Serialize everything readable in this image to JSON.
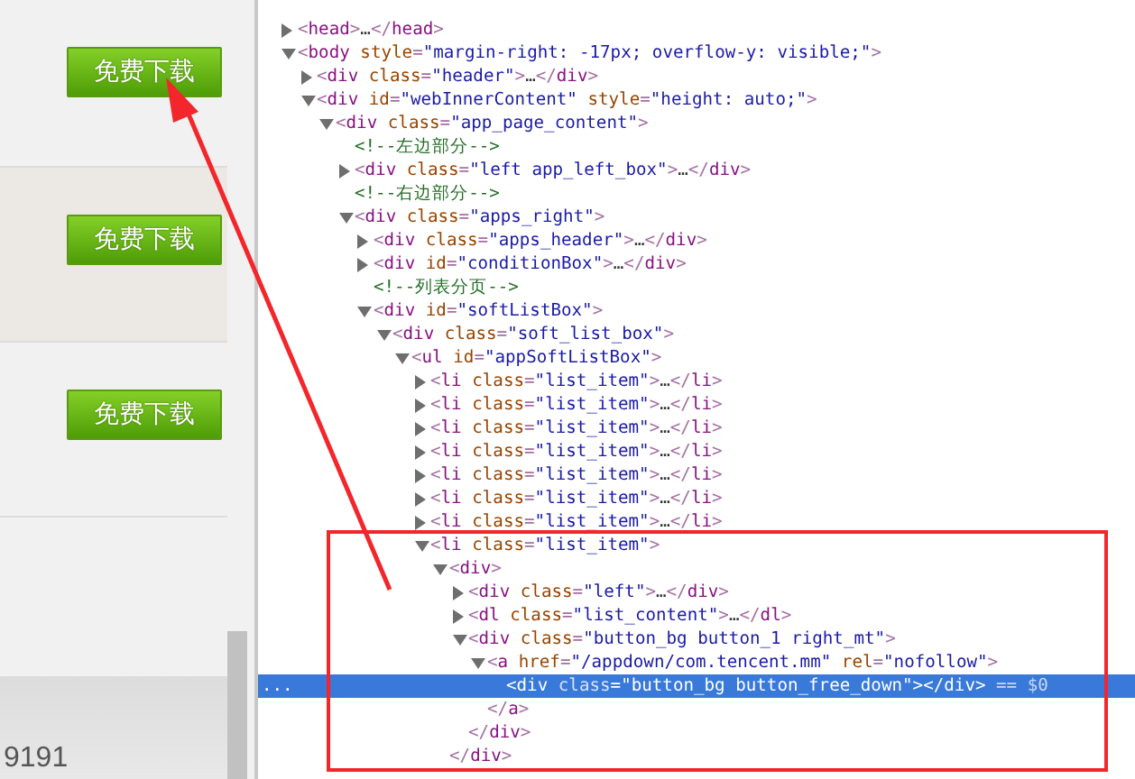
{
  "web_page": {
    "list_items": [
      {
        "button_label": "免费下载",
        "highlighted": false
      },
      {
        "button_label": "免费下载",
        "highlighted": true
      },
      {
        "button_label": "免费下载",
        "highlighted": false
      }
    ],
    "footer_text": "9191"
  },
  "dom_tree": [
    {
      "kind": "element",
      "text": "<head>…</head>",
      "expanded": false,
      "selected": false
    },
    {
      "kind": "element",
      "text": "<body style=\"margin-right: -17px; overflow-y: visible;\">",
      "expanded": true,
      "selected": false,
      "children": [
        {
          "kind": "element",
          "text": "<div class=\"header\">…</div>",
          "expanded": false,
          "selected": false
        },
        {
          "kind": "element",
          "text": "<div id=\"webInnerContent\" style=\"height: auto;\">",
          "expanded": true,
          "selected": false,
          "children": [
            {
              "kind": "element",
              "text": "<div class=\"app_page_content\">",
              "expanded": true,
              "selected": false,
              "children": [
                {
                  "kind": "comment",
                  "text": "<!--左边部分-->",
                  "selected": false
                },
                {
                  "kind": "element",
                  "text": "<div class=\"left app_left_box\">…</div>",
                  "expanded": false,
                  "selected": false
                },
                {
                  "kind": "comment",
                  "text": "<!--右边部分-->",
                  "selected": false
                },
                {
                  "kind": "element",
                  "text": "<div class=\"apps_right\">",
                  "expanded": true,
                  "selected": false,
                  "children": [
                    {
                      "kind": "element",
                      "text": "<div class=\"apps_header\">…</div>",
                      "expanded": false,
                      "selected": false
                    },
                    {
                      "kind": "element",
                      "text": "<div id=\"conditionBox\">…</div>",
                      "expanded": false,
                      "selected": false
                    },
                    {
                      "kind": "comment",
                      "text": "<!--列表分页-->",
                      "selected": false
                    },
                    {
                      "kind": "element",
                      "text": "<div id=\"softListBox\">",
                      "expanded": true,
                      "selected": false,
                      "children": [
                        {
                          "kind": "element",
                          "text": "<div class=\"soft_list_box\">",
                          "expanded": true,
                          "selected": false,
                          "children": [
                            {
                              "kind": "element",
                              "text": "<ul id=\"appSoftListBox\">",
                              "expanded": true,
                              "selected": false,
                              "children": [
                                {
                                  "kind": "element",
                                  "text": "<li class=\"list_item\">…</li>",
                                  "expanded": false,
                                  "selected": false
                                },
                                {
                                  "kind": "element",
                                  "text": "<li class=\"list_item\">…</li>",
                                  "expanded": false,
                                  "selected": false
                                },
                                {
                                  "kind": "element",
                                  "text": "<li class=\"list_item\">…</li>",
                                  "expanded": false,
                                  "selected": false
                                },
                                {
                                  "kind": "element",
                                  "text": "<li class=\"list_item\">…</li>",
                                  "expanded": false,
                                  "selected": false
                                },
                                {
                                  "kind": "element",
                                  "text": "<li class=\"list_item\">…</li>",
                                  "expanded": false,
                                  "selected": false
                                },
                                {
                                  "kind": "element",
                                  "text": "<li class=\"list_item\">…</li>",
                                  "expanded": false,
                                  "selected": false
                                },
                                {
                                  "kind": "element",
                                  "text": "<li class=\"list_item\">…</li>",
                                  "expanded": false,
                                  "selected": false
                                },
                                {
                                  "kind": "element",
                                  "text": "<li class=\"list_item\">",
                                  "expanded": true,
                                  "selected": false,
                                  "children": [
                                    {
                                      "kind": "element",
                                      "text": "<div>",
                                      "expanded": true,
                                      "selected": false,
                                      "close": "</div>",
                                      "children": [
                                        {
                                          "kind": "element",
                                          "text": "<div class=\"left\">…</div>",
                                          "expanded": false,
                                          "selected": false
                                        },
                                        {
                                          "kind": "element",
                                          "text": "<dl class=\"list_content\">…</dl>",
                                          "expanded": false,
                                          "selected": false
                                        },
                                        {
                                          "kind": "element",
                                          "text": "<div class=\"button_bg button_1 right_mt\">",
                                          "expanded": true,
                                          "selected": false,
                                          "close": "</div>",
                                          "children": [
                                            {
                                              "kind": "element",
                                              "text": "<a href=\"/appdown/com.tencent.mm\" rel=\"nofollow\">",
                                              "expanded": true,
                                              "selected": false,
                                              "close": "</a>",
                                              "children": [
                                                {
                                                  "kind": "leaf",
                                                  "text": "<div class=\"button_bg button_free_down\"></div>",
                                                  "selected": true,
                                                  "suffix": "== $0",
                                                  "gutter": "..."
                                                }
                                              ]
                                            }
                                          ]
                                        }
                                      ]
                                    }
                                  ]
                                }
                              ]
                            }
                          ]
                        }
                      ]
                    }
                  ]
                }
              ]
            }
          ]
        }
      ]
    }
  ],
  "annotations": {
    "highlight_rectangle": true,
    "pointer_arrow": true
  }
}
